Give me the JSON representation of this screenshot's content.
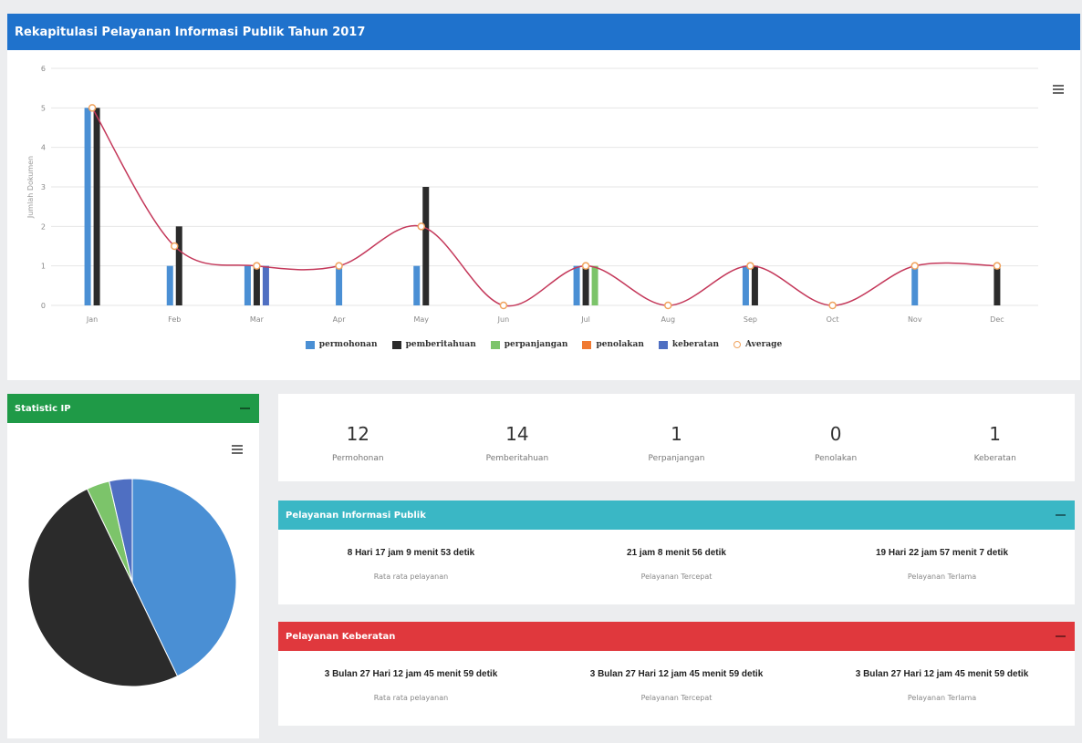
{
  "chart_panel": {
    "title": "Rekapitulasi Pelayanan Informasi Publik Tahun 2017"
  },
  "chart_data": {
    "type": "bar",
    "title": "",
    "ylabel": "Jumlah Dokumen",
    "ylim": [
      0,
      6
    ],
    "yticks": [
      "0",
      "1",
      "2",
      "3",
      "4",
      "5",
      "6"
    ],
    "categories": [
      "Jan",
      "Feb",
      "Mar",
      "Apr",
      "May",
      "Jun",
      "Jul",
      "Aug",
      "Sep",
      "Oct",
      "Nov",
      "Dec"
    ],
    "series": [
      {
        "name": "permohonan",
        "color": "#4a8fd4",
        "values": [
          5,
          1,
          1,
          1,
          1,
          0,
          1,
          0,
          1,
          0,
          1,
          0
        ]
      },
      {
        "name": "pemberitahuan",
        "color": "#2b2b2b",
        "values": [
          5,
          2,
          1,
          0,
          3,
          0,
          1,
          0,
          1,
          0,
          0,
          1
        ]
      },
      {
        "name": "perpanjangan",
        "color": "#7cc46a",
        "values": [
          0,
          0,
          0,
          0,
          0,
          0,
          1,
          0,
          0,
          0,
          0,
          0
        ]
      },
      {
        "name": "penolakan",
        "color": "#f07a32",
        "values": [
          0,
          0,
          0,
          0,
          0,
          0,
          0,
          0,
          0,
          0,
          0,
          0
        ]
      },
      {
        "name": "keberatan",
        "color": "#4f6fc2",
        "values": [
          0,
          0,
          1,
          0,
          0,
          0,
          0,
          0,
          0,
          0,
          0,
          0
        ]
      }
    ],
    "average": {
      "name": "Average",
      "color": "#c4385a",
      "values": [
        5,
        1.5,
        1,
        1,
        2,
        0,
        1,
        0,
        1,
        0,
        1,
        1
      ]
    },
    "legend_position": "bottom"
  },
  "stat_panel": {
    "title": "Statistic IP",
    "pie": [
      {
        "name": "permohonan",
        "value": 12,
        "color": "#4a8fd4"
      },
      {
        "name": "pemberitahuan",
        "value": 14,
        "color": "#2b2b2b"
      },
      {
        "name": "perpanjangan",
        "value": 1,
        "color": "#7cc46a"
      },
      {
        "name": "keberatan",
        "value": 1,
        "color": "#4f6fc2"
      }
    ]
  },
  "counts": [
    {
      "value": "12",
      "label": "Permohonan"
    },
    {
      "value": "14",
      "label": "Pemberitahuan"
    },
    {
      "value": "1",
      "label": "Perpanjangan"
    },
    {
      "value": "0",
      "label": "Penolakan"
    },
    {
      "value": "1",
      "label": "Keberatan"
    }
  ],
  "svc_info": {
    "title": "Pelayanan Informasi Publik",
    "items": [
      {
        "value": "8 Hari 17 jam 9 menit 53 detik",
        "label": "Rata rata pelayanan"
      },
      {
        "value": "21 jam 8 menit 56 detik",
        "label": "Pelayanan Tercepat"
      },
      {
        "value": "19 Hari 22 jam 57 menit 7 detik",
        "label": "Pelayanan Terlama"
      }
    ]
  },
  "svc_keberatan": {
    "title": "Pelayanan Keberatan",
    "items": [
      {
        "value": "3 Bulan 27 Hari 12 jam 45 menit 59 detik",
        "label": "Rata rata pelayanan"
      },
      {
        "value": "3 Bulan 27 Hari 12 jam 45 menit 59 detik",
        "label": "Pelayanan Tercepat"
      },
      {
        "value": "3 Bulan 27 Hari 12 jam 45 menit 59 detik",
        "label": "Pelayanan Terlama"
      }
    ]
  }
}
